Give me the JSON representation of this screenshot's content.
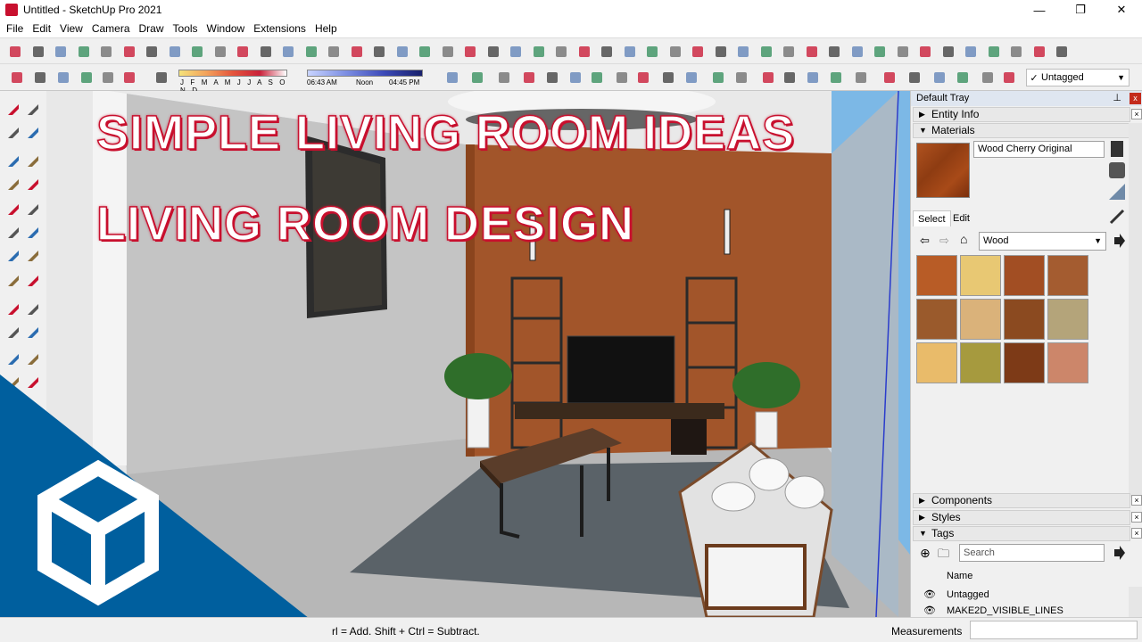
{
  "window": {
    "title": "Untitled - SketchUp Pro 2021",
    "controls": {
      "minimize": "—",
      "maximize": "❐",
      "close": "✕"
    }
  },
  "menu": [
    "File",
    "Edit",
    "View",
    "Camera",
    "Draw",
    "Tools",
    "Window",
    "Extensions",
    "Help"
  ],
  "shadow": {
    "months": "J F M A M J J A S O N D",
    "time_start": "06:43 AM",
    "time_mid": "Noon",
    "time_end": "04:45 PM"
  },
  "tag_dropdown": {
    "check": "✓",
    "value": "Untagged"
  },
  "headline": {
    "line1": "SIMPLE LIVING ROOM IDEAS",
    "line2": "LIVING ROOM DESIGN"
  },
  "status": {
    "hint": "rl = Add. Shift + Ctrl = Subtract.",
    "measurements_label": "Measurements"
  },
  "tray": {
    "title": "Default Tray",
    "pin": "📌",
    "close": "x",
    "panels": {
      "entity_info": "Entity Info",
      "materials": "Materials",
      "components": "Components",
      "styles": "Styles",
      "tags": "Tags"
    },
    "materials": {
      "current_name": "Wood Cherry Original",
      "tab_select": "Select",
      "tab_edit": "Edit",
      "library": "Wood",
      "swatch_colors": [
        "#b85c26",
        "#e8c873",
        "#a24e23",
        "#a45c30",
        "#9a5a2c",
        "#dab27a",
        "#8b4a20",
        "#b4a47a",
        "#e9bb6a",
        "#a69a3e",
        "#7d3a17",
        "#cc866a"
      ]
    },
    "tags": {
      "search_placeholder": "Search",
      "column_name": "Name",
      "rows": [
        "Untagged",
        "MAKE2D_VISIBLE_LINES"
      ]
    }
  },
  "colors": {
    "brand_blue": "#005f9e",
    "headline_outline": "#c8102e"
  }
}
